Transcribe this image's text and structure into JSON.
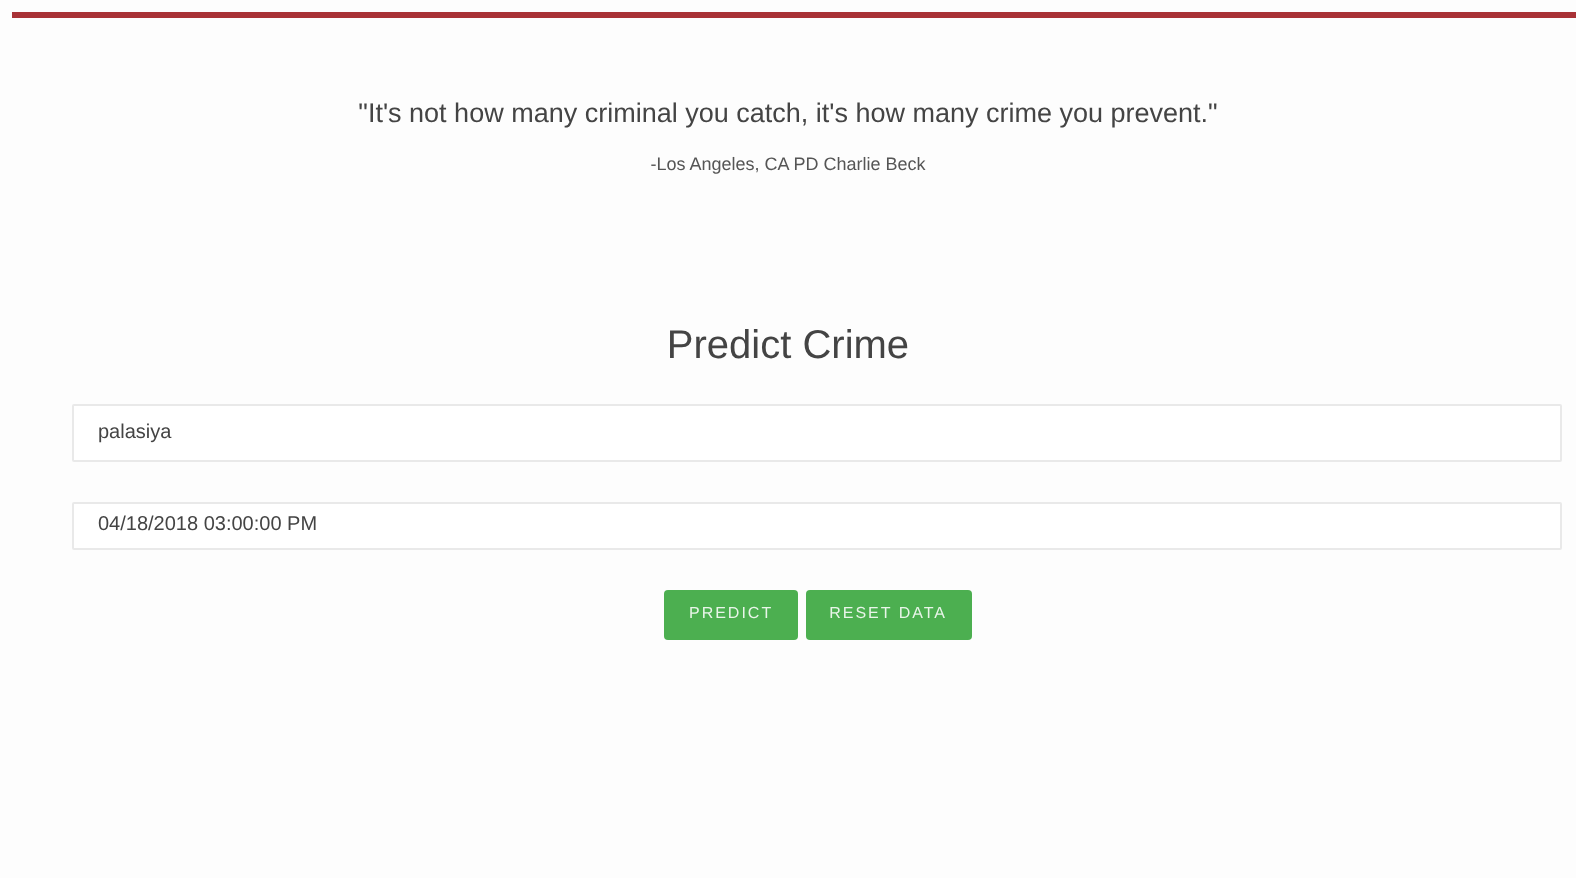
{
  "quote": "\"It's not how many criminal you catch, it's how many crime you prevent.\"",
  "attribution": "-Los Angeles, CA PD Charlie Beck",
  "title": "Predict Crime",
  "fields": [
    {
      "value": "palasiya"
    },
    {
      "value": "04/18/2018 03:00:00 PM"
    }
  ],
  "buttons": [
    "PREDICT",
    "RESET DATA"
  ]
}
